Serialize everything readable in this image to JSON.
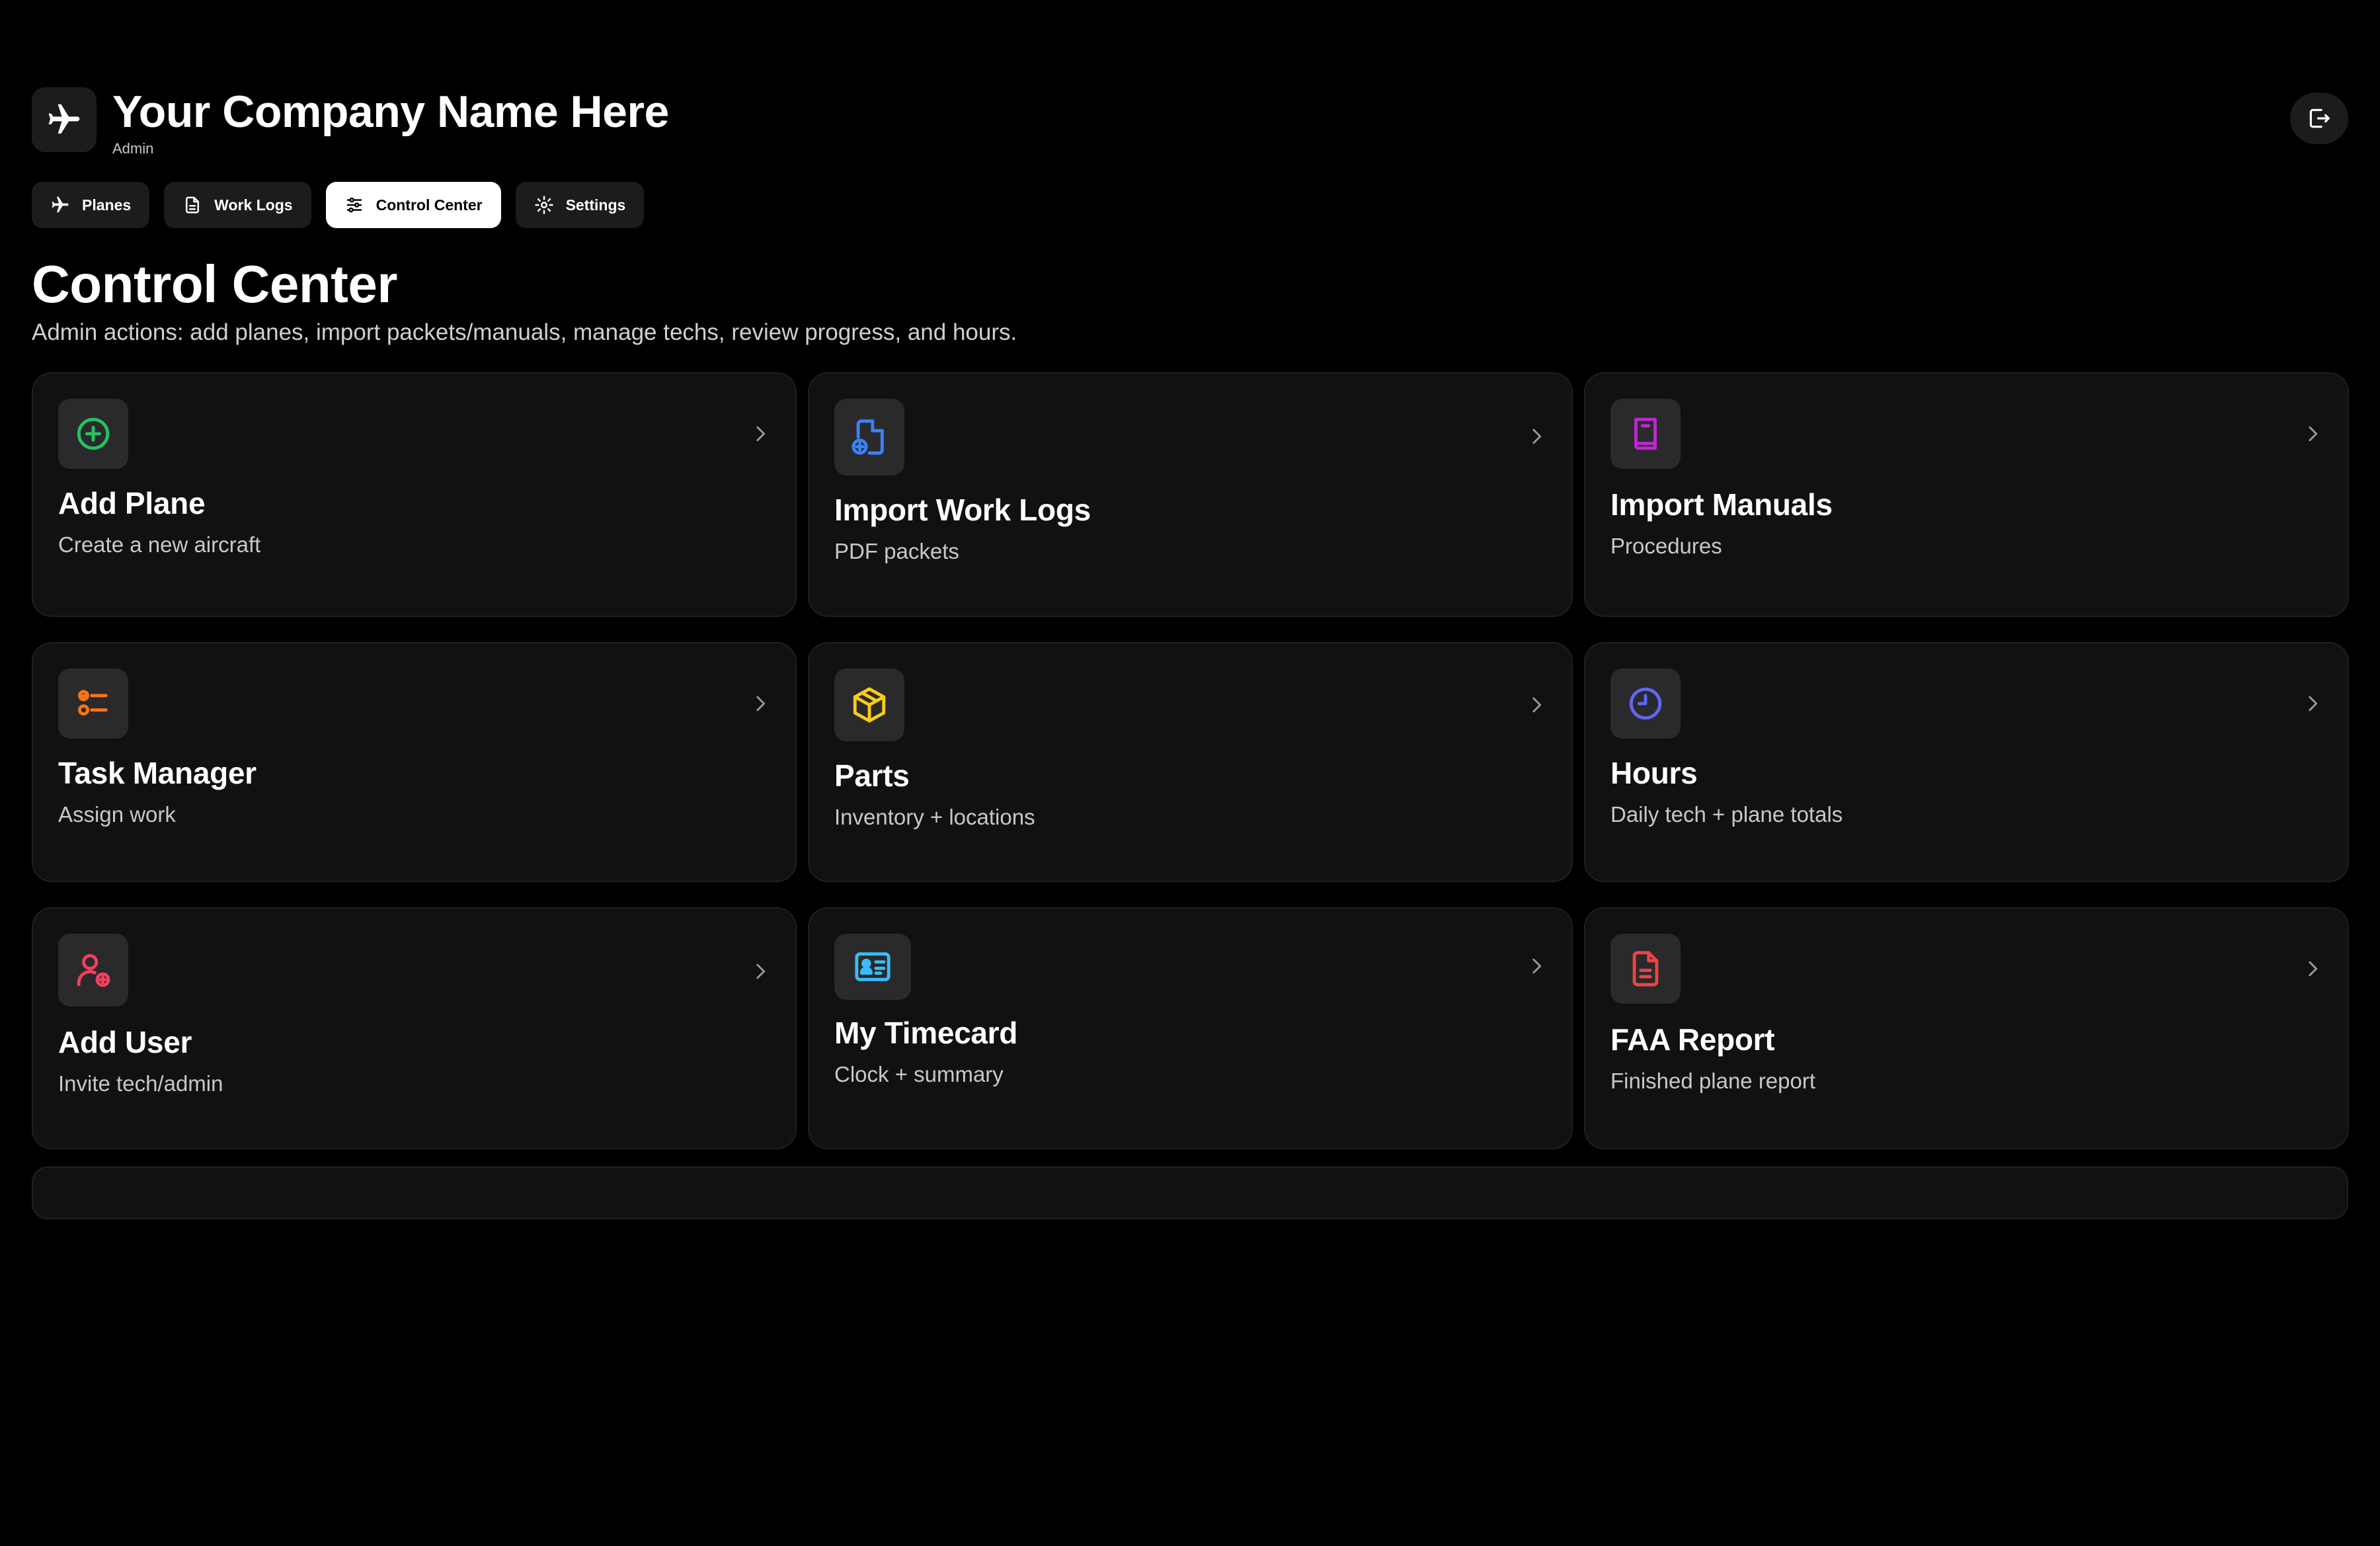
{
  "header": {
    "company_name": "Your Company Name Here",
    "role": "Admin",
    "logo_icon": "plane-icon",
    "logout_icon": "logout-icon"
  },
  "tabs": [
    {
      "label": "Planes",
      "icon": "plane-icon",
      "active": false
    },
    {
      "label": "Work Logs",
      "icon": "document-icon",
      "active": false
    },
    {
      "label": "Control Center",
      "icon": "sliders-icon",
      "active": true
    },
    {
      "label": "Settings",
      "icon": "gear-icon",
      "active": false
    }
  ],
  "page": {
    "title": "Control Center",
    "subtitle": "Admin actions: add planes, import packets/manuals, manage techs, review progress, and hours."
  },
  "cards": [
    {
      "title": "Add Plane",
      "subtitle": "Create a new aircraft",
      "icon": "plus-circle-icon",
      "color": "#22c55e"
    },
    {
      "title": "Import Work Logs",
      "subtitle": "PDF packets",
      "icon": "file-plus-icon",
      "color": "#3b82f6"
    },
    {
      "title": "Import Manuals",
      "subtitle": "Procedures",
      "icon": "book-icon",
      "color": "#c026d3"
    },
    {
      "title": "Task Manager",
      "subtitle": "Assign work",
      "icon": "task-list-icon",
      "color": "#f97316"
    },
    {
      "title": "Parts",
      "subtitle": "Inventory + locations",
      "icon": "package-icon",
      "color": "#facc15"
    },
    {
      "title": "Hours",
      "subtitle": "Daily tech + plane totals",
      "icon": "clock-icon",
      "color": "#6366f1"
    },
    {
      "title": "Add User",
      "subtitle": "Invite tech/admin",
      "icon": "user-plus-icon",
      "color": "#f43f5e"
    },
    {
      "title": "My Timecard",
      "subtitle": "Clock + summary",
      "icon": "id-card-icon",
      "color": "#38bdf8"
    },
    {
      "title": "FAA Report",
      "subtitle": "Finished plane report",
      "icon": "report-icon",
      "color": "#ef4444"
    }
  ]
}
